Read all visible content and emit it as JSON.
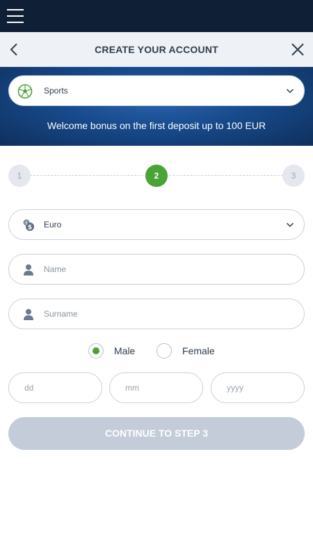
{
  "topbar": {
    "menu_icon": "hamburger-menu-icon"
  },
  "header": {
    "title": "CREATE YOUR ACCOUNT",
    "back_icon": "chevron-left-icon",
    "close_icon": "close-icon"
  },
  "banner": {
    "sport_select": {
      "value": "Sports",
      "icon": "soccer-ball-icon",
      "chevron": "chevron-down-icon"
    },
    "bonus_text": "Welcome bonus on the first deposit up to 100 EUR"
  },
  "steps": {
    "items": [
      {
        "label": "1",
        "state": "inactive"
      },
      {
        "label": "2",
        "state": "active"
      },
      {
        "label": "3",
        "state": "inactive"
      }
    ]
  },
  "form": {
    "currency": {
      "value": "Euro",
      "icon": "money-bag-icon"
    },
    "name": {
      "placeholder": "Name",
      "value": "",
      "icon": "user-icon"
    },
    "surname": {
      "placeholder": "Surname",
      "value": "",
      "icon": "user-icon"
    },
    "gender": {
      "options": [
        {
          "label": "Male",
          "checked": true
        },
        {
          "label": "Female",
          "checked": false
        }
      ]
    },
    "birthdate": {
      "day_placeholder": "dd",
      "month_placeholder": "mm",
      "year_placeholder": "yyyy"
    },
    "continue_label": "CONTINUE TO STEP 3"
  },
  "colors": {
    "topbar_bg": "#0f1f35",
    "banner_blue": "#174a8c",
    "accent_green": "#4aa336",
    "disabled_button": "#c3ccd8"
  }
}
